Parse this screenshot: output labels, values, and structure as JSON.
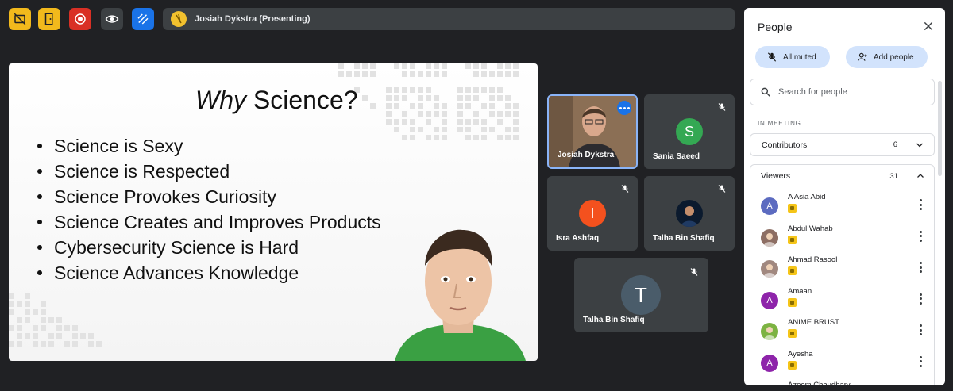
{
  "toolbar": {
    "buttons": [
      {
        "icon": "no-video-icon",
        "color": "#f2b91c"
      },
      {
        "icon": "exit-door-icon",
        "color": "#f2b91c"
      },
      {
        "icon": "record-icon",
        "color": "#d93025"
      },
      {
        "icon": "eye-icon",
        "color": "#3c4043"
      },
      {
        "icon": "whiteboard-icon",
        "color": "#1a73e8"
      }
    ],
    "presenting_label": "Josiah Dykstra (Presenting)"
  },
  "slide": {
    "title_italic": "Why",
    "title_rest": " Science?",
    "bullets": [
      "Science is Sexy",
      "Science is Respected",
      "Science Provokes Curiosity",
      "Science Creates and Improves Products",
      "Cybersecurity Science is Hard",
      "Science Advances Knowledge"
    ]
  },
  "tiles": [
    {
      "name": "Josiah Dykstra",
      "initial": "",
      "avatar_color": "",
      "muted": false,
      "video": true
    },
    {
      "name": "Sania Saeed",
      "initial": "S",
      "avatar_color": "#34a853",
      "muted": true
    },
    {
      "name": "Isra Ashfaq",
      "initial": "I",
      "avatar_color": "#f4511e",
      "muted": true
    },
    {
      "name": "Talha Bin Shafiq",
      "initial": "",
      "avatar_color": "#0b1a2e",
      "muted": true,
      "photo": true
    },
    {
      "name": "Talha Bin Shafiq",
      "initial": "T",
      "avatar_color": "#4a5c6a",
      "muted": true
    }
  ],
  "panel": {
    "title": "People",
    "all_muted_label": "All muted",
    "add_people_label": "Add people",
    "search_placeholder": "Search for people",
    "section_label": "IN MEETING",
    "contributors": {
      "label": "Contributors",
      "count": "6"
    },
    "viewers": {
      "label": "Viewers",
      "count": "31"
    },
    "people": [
      {
        "name": "A Asia Abid",
        "initial": "A",
        "color": "#5c6bc0"
      },
      {
        "name": "Abdul Wahab",
        "initial": "",
        "color": "#8d6e63"
      },
      {
        "name": "Ahmad Rasool",
        "initial": "",
        "color": "#a1887f"
      },
      {
        "name": "Amaan",
        "initial": "A",
        "color": "#8e24aa"
      },
      {
        "name": "ANIME BRUST",
        "initial": "",
        "color": "#7cb342"
      },
      {
        "name": "Ayesha",
        "initial": "A",
        "color": "#8e24aa"
      },
      {
        "name": "Azeem Chaudhary",
        "initial": "",
        "color": "#43a047"
      }
    ]
  }
}
